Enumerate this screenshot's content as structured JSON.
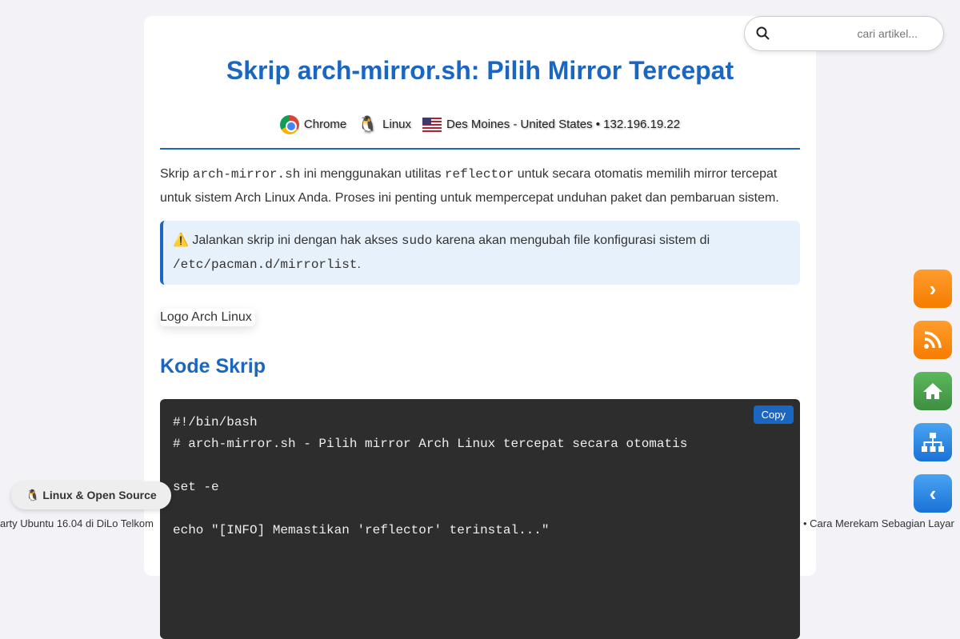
{
  "title": "Skrip arch-mirror.sh: Pilih Mirror Tercepat",
  "meta": {
    "browser": "Chrome",
    "os": "Linux",
    "location": "Des Moines - United States • 132.196.19.22"
  },
  "intro": {
    "t1": "Skrip ",
    "c1": "arch-mirror.sh",
    "t2": " ini menggunakan utilitas ",
    "c2": "reflector",
    "t3": " untuk secara otomatis memilih mirror tercepat untuk sistem Arch Linux Anda. Proses ini penting untuk mempercepat unduhan paket dan pembaruan sistem."
  },
  "note": {
    "t1": "⚠️ Jalankan skrip ini dengan hak akses ",
    "c1": "sudo",
    "t2": " karena akan mengubah file konfigurasi sistem di ",
    "c2": "/etc/pacman.d/mirrorlist",
    "t3": "."
  },
  "image_alt": "Logo Arch Linux",
  "section_title": "Kode Skrip",
  "code": "#!/bin/bash\n# arch-mirror.sh - Pilih mirror Arch Linux tercepat secara otomatis\n\nset -e\n\necho \"[INFO] Memastikan 'reflector' terinstal...\"",
  "copy_label": "Copy",
  "search_placeholder": "cari artikel...",
  "badge": "🐧 Linux & Open Source",
  "ticker_left": "arty Ubuntu 16.04 di DiLo Telkom",
  "ticker_right": "• Cara Merekam Sebagian Layar"
}
